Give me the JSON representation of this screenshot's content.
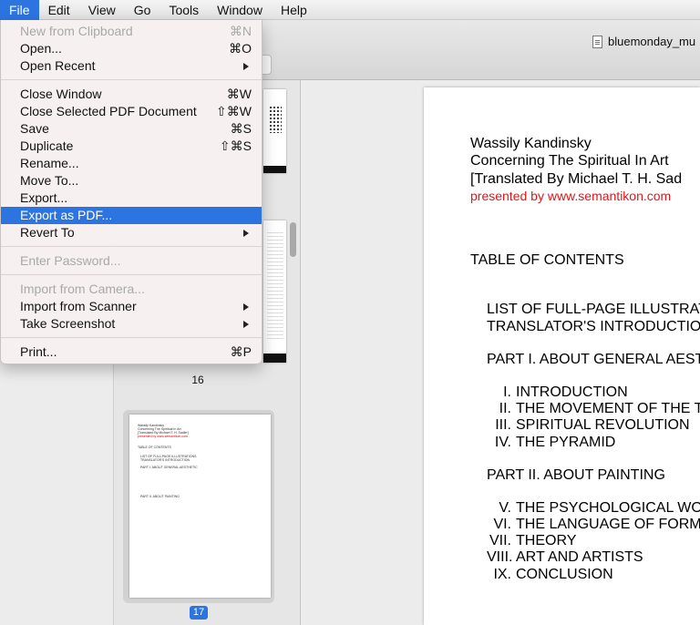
{
  "menubar": {
    "items": [
      "File",
      "Edit",
      "View",
      "Go",
      "Tools",
      "Window",
      "Help"
    ]
  },
  "window": {
    "document_title": "bluemonday_mu"
  },
  "file_menu": {
    "items": [
      {
        "label": "New from Clipboard",
        "shortcut": "⌘N",
        "enabled": false
      },
      {
        "label": "Open...",
        "shortcut": "⌘O",
        "enabled": true
      },
      {
        "label": "Open Recent",
        "shortcut": "",
        "enabled": true,
        "submenu": true
      },
      {
        "label": "Close Window",
        "shortcut": "⌘W",
        "enabled": true
      },
      {
        "label": "Close Selected PDF Document",
        "shortcut": "⇧⌘W",
        "enabled": true
      },
      {
        "label": "Save",
        "shortcut": "⌘S",
        "enabled": true
      },
      {
        "label": "Duplicate",
        "shortcut": "⇧⌘S",
        "enabled": true
      },
      {
        "label": "Rename...",
        "shortcut": "",
        "enabled": true
      },
      {
        "label": "Move To...",
        "shortcut": "",
        "enabled": true
      },
      {
        "label": "Export...",
        "shortcut": "",
        "enabled": true
      },
      {
        "label": "Export as PDF...",
        "shortcut": "",
        "enabled": true,
        "highlighted": true
      },
      {
        "label": "Revert To",
        "shortcut": "",
        "enabled": true,
        "submenu": true
      },
      {
        "label": "Enter Password...",
        "shortcut": "",
        "enabled": false
      },
      {
        "label": "Import from Camera...",
        "shortcut": "",
        "enabled": false
      },
      {
        "label": "Import from Scanner",
        "shortcut": "",
        "enabled": true,
        "submenu": true
      },
      {
        "label": "Take Screenshot",
        "shortcut": "",
        "enabled": true,
        "submenu": true
      },
      {
        "label": "Print...",
        "shortcut": "⌘P",
        "enabled": true
      }
    ]
  },
  "sidebar": {
    "page_numbers": [
      "16",
      "17"
    ],
    "selected_page": "17",
    "thumb17_lines": [
      "Wassily Kandinsky",
      "Concerning The Spiritual In Art",
      "[Translated By Michael T. H. Sadler]",
      "presented by www.semantikon.com",
      "TABLE OF CONTENTS",
      "LIST OF FULL-PAGE ILLUSTRATIONS",
      "TRANSLATOR'S INTRODUCTION",
      "PART I. ABOUT GENERAL AESTHETIC",
      "PART II. ABOUT PAINTING"
    ]
  },
  "page": {
    "author": "Wassily Kandinsky",
    "title": "Concerning The Spiritual In Art",
    "translator": "[Translated By Michael T. H. Sad",
    "presented_by": "presented by www.semantikon.com",
    "toc_heading": "TABLE OF CONTENTS",
    "list_illustrations": "LIST OF FULL-PAGE ILLUSTRAT",
    "translator_intro": "TRANSLATOR'S INTRODUCTIO",
    "part1": "PART I. ABOUT GENERAL AEST",
    "part1_items": [
      {
        "num": "I.",
        "text": "INTRODUCTION"
      },
      {
        "num": "II.",
        "text": "THE MOVEMENT OF THE TR"
      },
      {
        "num": "III.",
        "text": "SPIRITUAL REVOLUTION"
      },
      {
        "num": "IV.",
        "text": "THE PYRAMID"
      }
    ],
    "part2": "PART II. ABOUT PAINTING",
    "part2_items": [
      {
        "num": "V.",
        "text": "THE PSYCHOLOGICAL WO"
      },
      {
        "num": "VI.",
        "text": "THE LANGUAGE OF FORM"
      },
      {
        "num": "VII.",
        "text": "THEORY"
      },
      {
        "num": "VIII.",
        "text": "ART AND ARTISTS"
      },
      {
        "num": "IX.",
        "text": "CONCLUSION"
      }
    ]
  },
  "colors": {
    "accent": "#2c75e0",
    "link_red": "#e8141a"
  }
}
